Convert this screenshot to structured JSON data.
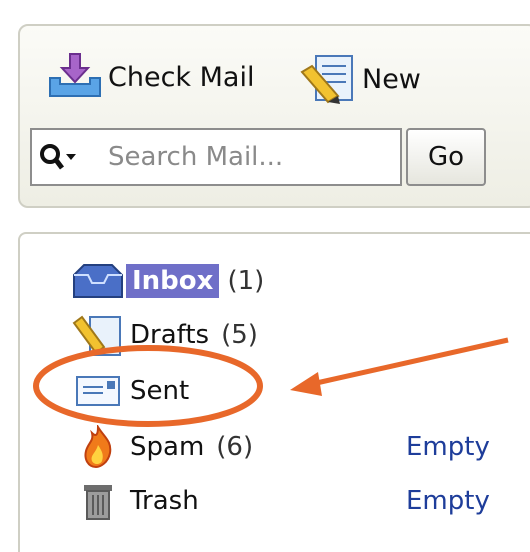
{
  "toolbar": {
    "check_mail_label": "Check Mail",
    "new_label": "New",
    "search_placeholder": "Search Mail...",
    "go_label": "Go"
  },
  "folders": [
    {
      "label": "Inbox",
      "count": "(1)"
    },
    {
      "label": "Drafts",
      "count": "(5)"
    },
    {
      "label": "Sent",
      "count": ""
    },
    {
      "label": "Spam",
      "count": "(6)",
      "action": "Empty"
    },
    {
      "label": "Trash",
      "count": "",
      "action": "Empty"
    }
  ],
  "colors": {
    "selected_folder_bg": "#6f6fc8",
    "link_color": "#1e3d9a",
    "annotation_color": "#e8682a"
  },
  "icons": {
    "check_mail": "envelope-download-icon",
    "new": "compose-pencil-icon",
    "search": "magnifier-dropdown-icon",
    "inbox": "inbox-tray-icon",
    "drafts": "draft-pencil-icon",
    "sent": "sent-envelope-icon",
    "spam": "flame-icon",
    "trash": "trash-can-icon"
  }
}
